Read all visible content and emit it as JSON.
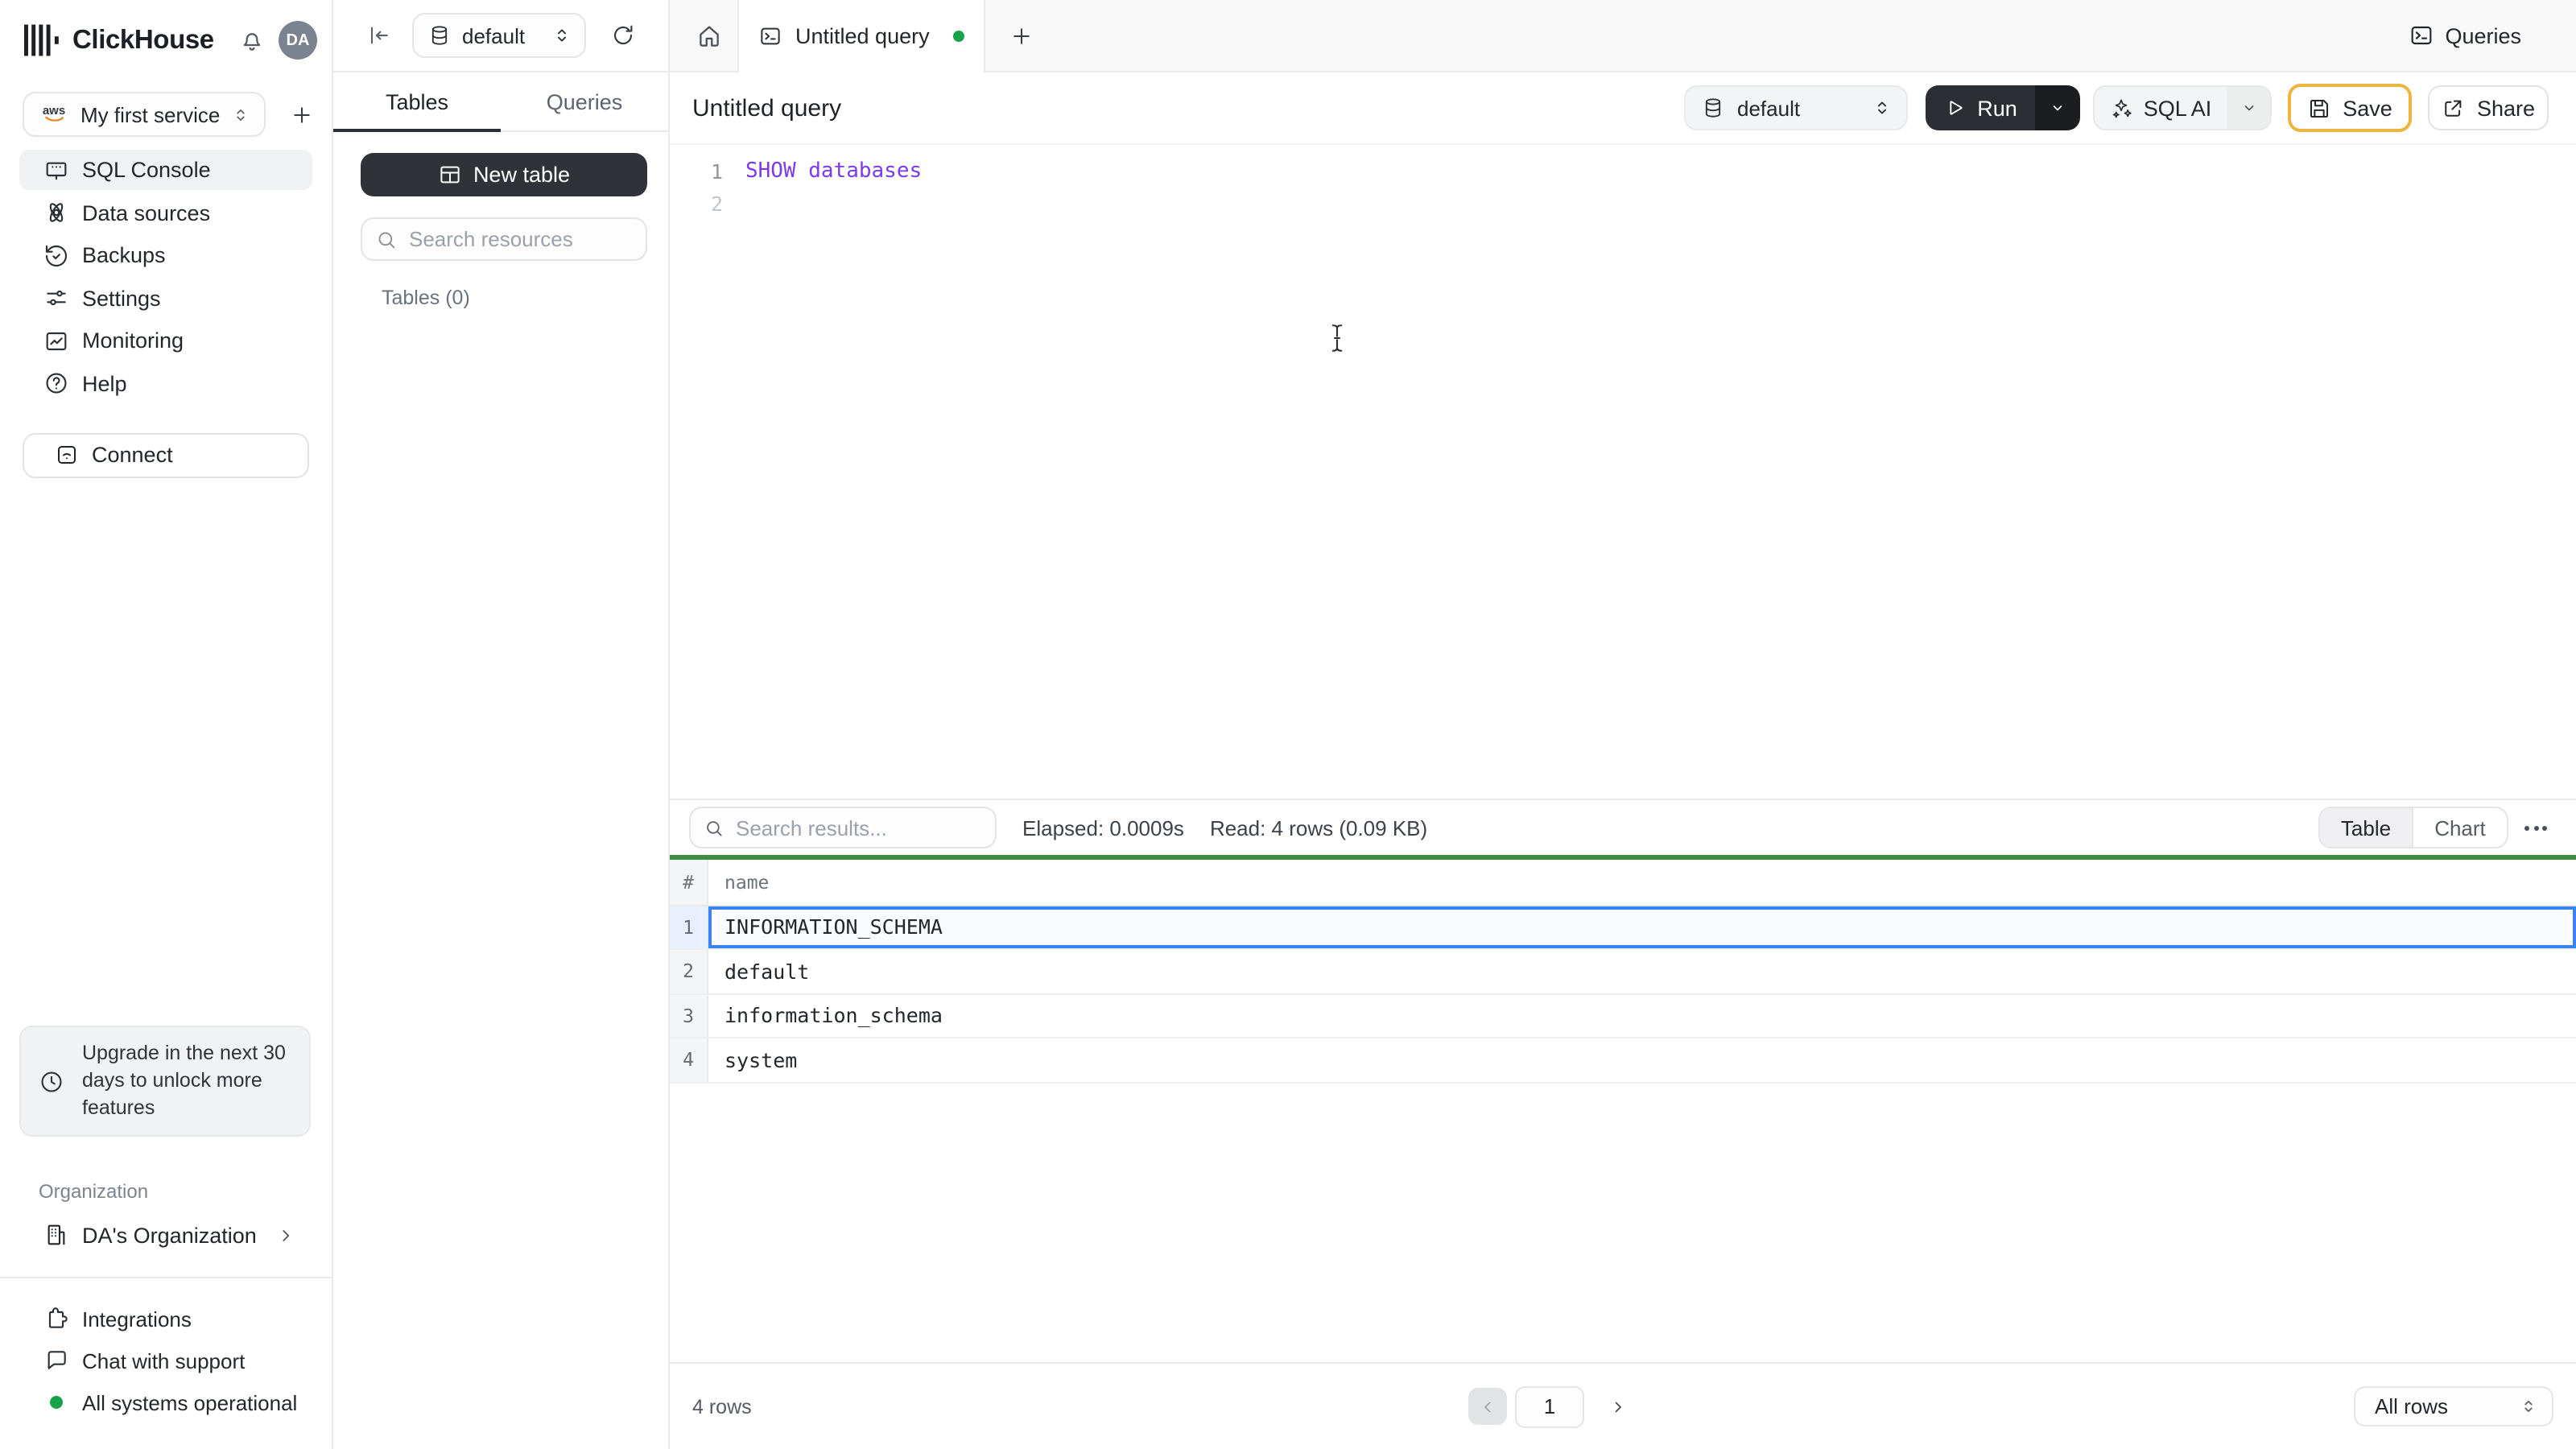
{
  "sidebar": {
    "brand": "ClickHouse",
    "avatar_initials": "DA",
    "service": {
      "provider": "aws",
      "name": "My first service"
    },
    "nav": [
      {
        "label": "SQL Console",
        "active": true
      },
      {
        "label": "Data sources",
        "active": false
      },
      {
        "label": "Backups",
        "active": false
      },
      {
        "label": "Settings",
        "active": false
      },
      {
        "label": "Monitoring",
        "active": false
      },
      {
        "label": "Help",
        "active": false
      }
    ],
    "connect_label": "Connect",
    "upgrade_notice": "Upgrade in the next 30 days to unlock more features",
    "organization": {
      "section_label": "Organization",
      "name": "DA's Organization"
    },
    "footer": {
      "integrations": "Integrations",
      "chat": "Chat with support",
      "status": "All systems operational",
      "status_color": "#16a34a"
    }
  },
  "explorer": {
    "database": "default",
    "tabs": {
      "tables": "Tables",
      "queries": "Queries"
    },
    "new_table": "New table",
    "search_placeholder": "Search resources",
    "section_label": "Tables (0)"
  },
  "workspace": {
    "tab": {
      "title": "Untitled query",
      "unsaved_indicator_color": "#1aa34a"
    },
    "queries_button": "Queries",
    "toolbar": {
      "title": "Untitled query",
      "database": "default",
      "run": "Run",
      "sql_ai": "SQL AI",
      "save": "Save",
      "share": "Share",
      "save_highlight_color": "#eeb53e"
    },
    "editor": {
      "lines": [
        {
          "number": "1",
          "code": "SHOW databases"
        },
        {
          "number": "2",
          "code": ""
        }
      ],
      "keyword_color": "#7c3aed"
    },
    "results": {
      "search_placeholder": "Search results...",
      "elapsed": "Elapsed: 0.0009s",
      "read": "Read: 4 rows (0.09 KB)",
      "views": {
        "table": "Table",
        "chart": "Chart"
      },
      "accent_line_color": "#3f8b41",
      "grid": {
        "columns": {
          "index": "#",
          "name": "name"
        },
        "rows": [
          {
            "num": "1",
            "name": "INFORMATION_SCHEMA"
          },
          {
            "num": "2",
            "name": "default"
          },
          {
            "num": "3",
            "name": "information_schema"
          },
          {
            "num": "4",
            "name": "system"
          }
        ],
        "selected_row": 1,
        "selection_color": "#3b82f6"
      },
      "footer": {
        "count": "4 rows",
        "page": "1",
        "page_size": "All rows"
      }
    }
  }
}
